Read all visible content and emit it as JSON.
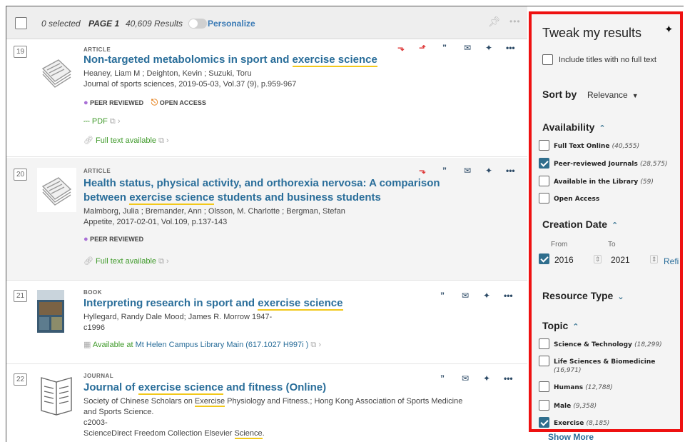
{
  "topbar": {
    "selected": "0 selected",
    "page": "PAGE 1",
    "results": "40,609 Results",
    "personalize": "Personalize"
  },
  "results": [
    {
      "num": "19",
      "type": "ARTICLE",
      "title_pre": "Non-targeted metabolomics in sport and ",
      "title_hl": "exercise science",
      "title_post": "",
      "authors": "Heaney, Liam M ; Deighton, Kevin ; Suzuki, Toru",
      "source": "Journal of sports sciences, 2019-05-03, Vol.37 (9), p.959-967",
      "badge_peer": "PEER REVIEWED",
      "badge_oa": "OPEN ACCESS",
      "pdf": "PDF",
      "fulltext": "Full text available"
    },
    {
      "num": "20",
      "type": "ARTICLE",
      "title_line1": "Health status, physical activity, and orthorexia nervosa: A comparison",
      "title_line2_pre": "between ",
      "title_hl": "exercise science",
      "title_line2_post": " students and business students",
      "authors": "Malmborg, Julia ; Bremander, Ann ; Olsson, M. Charlotte ; Bergman, Stefan",
      "source": "Appetite, 2017-02-01, Vol.109, p.137-143",
      "badge_peer": "PEER REVIEWED",
      "fulltext": "Full text available"
    },
    {
      "num": "21",
      "type": "BOOK",
      "title_pre": "Interpreting research in sport and ",
      "title_hl": "exercise science",
      "authors": "Hyllegard, Randy Dale Mood; James R. Morrow 1947-",
      "year": "c1996",
      "avail_pre": "Available at ",
      "avail_loc": "Mt Helen Campus Library  Main (617.1027 H997i )"
    },
    {
      "num": "22",
      "type": "JOURNAL",
      "title_pre": "Journal of ",
      "title_hl": "exercise science",
      "title_post": " and fitness (Online)",
      "meta1_pre": "Society of Chinese Scholars on ",
      "meta1_hl": "Exercise",
      "meta1_post": " Physiology and Fitness.; Hong Kong Association of Sports Medicine",
      "meta2": "and Sports Science.",
      "year": "c2003-",
      "collection_pre": "ScienceDirect Freedom Collection Elsevier ",
      "collection_hl": "Science",
      "collection_post": "."
    }
  ],
  "panel": {
    "title": "Tweak my results",
    "include_no_fulltext": "Include titles with no full text",
    "sort_by": "Sort by",
    "sort_value": "Relevance",
    "availability": "Availability",
    "availability_items": [
      {
        "label": "Full Text Online",
        "count": "(40,555)",
        "checked": false
      },
      {
        "label": "Peer-reviewed Journals",
        "count": "(28,575)",
        "checked": true
      },
      {
        "label": "Available in the Library",
        "count": "(59)",
        "checked": false
      },
      {
        "label": "Open Access",
        "count": "",
        "checked": false
      }
    ],
    "creation_date": "Creation Date",
    "from_label": "From",
    "to_label": "To",
    "from_year": "2016",
    "to_year": "2021",
    "refine": "Refi",
    "resource_type": "Resource Type",
    "topic": "Topic",
    "topic_items": [
      {
        "label": "Science & Technology",
        "count": "(18,299)",
        "checked": false
      },
      {
        "label": "Life Sciences & Biomedicine",
        "count": "(16,971)",
        "checked": false
      },
      {
        "label": "Humans",
        "count": "(12,788)",
        "checked": false
      },
      {
        "label": "Male",
        "count": "(9,358)",
        "checked": false
      },
      {
        "label": "Exercise",
        "count": "(8,185)",
        "checked": true
      }
    ],
    "show_more": "Show More"
  },
  "icons": [
    "pin-icon",
    "more-icon",
    "cite-icon",
    "email-icon",
    "pdf-icon",
    "external-link-icon",
    "chevron-right-icon",
    "link-icon",
    "open-access-icon",
    "peer-review-icon",
    "unpaywall-icon",
    "library-icon"
  ]
}
